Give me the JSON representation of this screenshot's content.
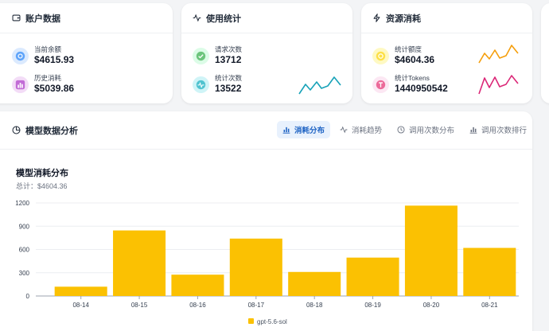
{
  "cards": {
    "account": {
      "title": "账户数据",
      "balance_label": "当前余额",
      "balance_value": "$4615.93",
      "history_label": "历史消耗",
      "history_value": "$5039.86"
    },
    "usage": {
      "title": "使用统计",
      "requests_label": "请求次数",
      "requests_value": "13712",
      "count_label": "统计次数",
      "count_value": "13522"
    },
    "resource": {
      "title": "资源消耗",
      "quota_label": "统计额度",
      "quota_value": "$4604.36",
      "tokens_label": "统计Tokens",
      "tokens_value": "1440950542"
    }
  },
  "colors": {
    "blue": "#60a5fa",
    "purple": "#c26bd6",
    "green": "#6cc57c",
    "cyan": "#4fc3d0",
    "yellow": "#fde047",
    "pink": "#ec6a9a",
    "orange": "#f59e0b",
    "magenta": "#db2777",
    "teal": "#17a2b8",
    "bar": "#fbc102"
  },
  "icons": {
    "account": "wallet-icon",
    "usage": "activity-icon",
    "resource": "lightning-icon"
  },
  "analysis": {
    "title": "模型数据分析",
    "tabs": [
      "消耗分布",
      "消耗趋势",
      "调用次数分布",
      "调用次数排行"
    ],
    "active_tab": "消耗分布"
  },
  "chart_data": {
    "type": "bar",
    "title": "模型消耗分布",
    "subtitle": "总计：$4604.36",
    "categories": [
      "08-14",
      "08-15",
      "08-16",
      "08-17",
      "08-18",
      "08-19",
      "08-20",
      "08-21"
    ],
    "series": [
      {
        "name": "gpt-5.6-sol",
        "values": [
          120,
          845,
          275,
          740,
          310,
          495,
          1165,
          620
        ]
      }
    ],
    "ylim": [
      0,
      1200
    ],
    "yticks": [
      0,
      300,
      600,
      900,
      1200
    ],
    "grid": true,
    "legend": "bottom-center"
  }
}
